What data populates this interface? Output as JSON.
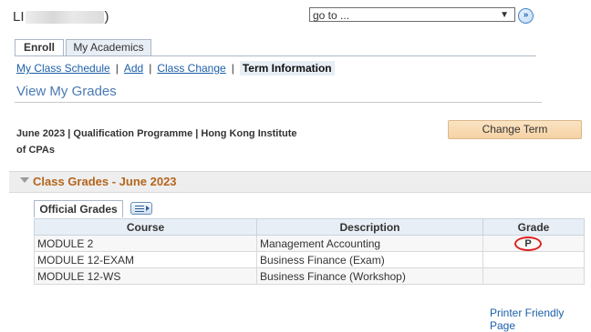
{
  "header": {
    "user_initial": "LI",
    "user_suffix": ")",
    "goto_value": "go to ...",
    "goto_button": "»"
  },
  "tabs": [
    {
      "label": "Enroll",
      "active": true
    },
    {
      "label": "My Academics",
      "active": false
    }
  ],
  "subnav": {
    "items": [
      "My Class Schedule",
      "Add",
      "Class Change",
      "Term Information"
    ],
    "separator": "|"
  },
  "page_title": "View My Grades",
  "term": {
    "line1": "June 2023 | Qualification Programme | Hong Kong Institute",
    "line2": "of CPAs",
    "change_button": "Change Term"
  },
  "section": {
    "title": "Class Grades - June 2023"
  },
  "grid": {
    "tab_label": "Official Grades",
    "columns": [
      "Course",
      "Description",
      "Grade"
    ],
    "rows": [
      {
        "course": "MODULE 2",
        "description": "Management Accounting",
        "grade": "P"
      },
      {
        "course": "MODULE 12-EXAM",
        "description": "Business Finance (Exam)",
        "grade": ""
      },
      {
        "course": "MODULE 12-WS",
        "description": "Business Finance (Workshop)",
        "grade": ""
      }
    ]
  },
  "footer": {
    "printer_link": "Printer Friendly Page"
  },
  "colors": {
    "link": "#1d5fa8",
    "section_title": "#b5651d",
    "highlight_circle": "#e02020",
    "button_bg": "#f6d2a4"
  }
}
